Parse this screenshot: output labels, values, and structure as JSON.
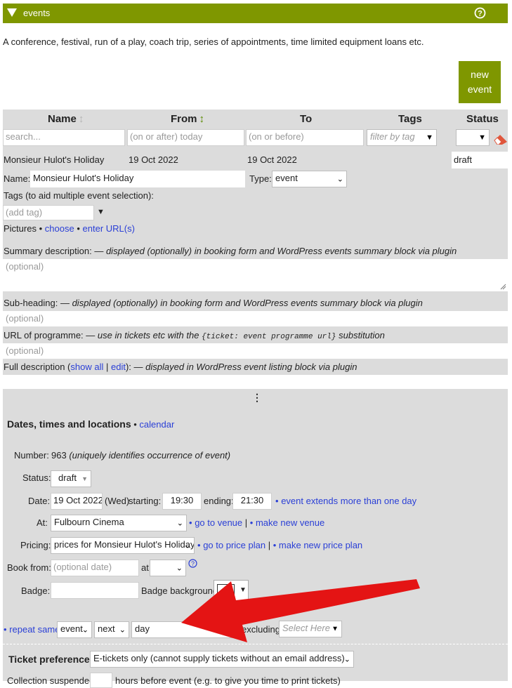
{
  "header": {
    "title": "events",
    "help_icon": "help-circle-icon",
    "bg": "#7f9700"
  },
  "intro": "A conference, festival, run of a play, coach trip, series of appointments, time limited equipment loans etc.",
  "new_event": {
    "line1": "new",
    "line2": "event",
    "bg": "#7f9700"
  },
  "columns": {
    "name": "Name",
    "from": "From",
    "to": "To",
    "tags": "Tags",
    "status": "Status"
  },
  "filters": {
    "search": "search...",
    "from": "(on or after) today",
    "to": "(on or before)",
    "tags": "filter by tag"
  },
  "event_row": {
    "name": "Monsieur Hulot's Holiday",
    "from": "19 Oct 2022",
    "to": "19 Oct 2022",
    "status": "draft"
  },
  "detail": {
    "name_label": "Name:",
    "name_value": "Monsieur Hulot's Holiday",
    "type_label": "Type:",
    "type_value": "event",
    "tags_label": "Tags (to aid multiple event selection):",
    "tags_placeholder": "(add tag)",
    "pictures_label": "Pictures",
    "pictures_choose": "choose",
    "pictures_url": "enter URL(s)",
    "bullet": "•",
    "summary_label": "Summary description:",
    "summary_note": "— displayed (optionally) in booking form and WordPress events summary block via plugin",
    "optional": "(optional)",
    "subheading_label": "Sub-heading:",
    "subheading_note": "— displayed (optionally) in booking form and WordPress events summary block via plugin",
    "url_label": "URL of programme:",
    "url_note_a": "— use in tickets etc with the",
    "url_code": "{ticket: event programme url}",
    "url_note_b": "substitution",
    "full_label": "Full description (",
    "full_show": "show all",
    "full_sep": "|",
    "full_edit": "edit",
    "full_close": "):",
    "full_note": "— displayed in WordPress event listing block via plugin",
    "dots": "⋮"
  },
  "dates": {
    "heading": "Dates, times and locations",
    "calendar": "calendar",
    "number_label": "Number:",
    "number_value": "963",
    "number_note": "(uniquely identifies occurrence of event)",
    "status_label": "Status:",
    "status_value": "draft",
    "date_label": "Date:",
    "date_value": "19 Oct 2022",
    "day": "(Wed)",
    "starting": "starting:",
    "start_time": "19:30",
    "ending": "ending:",
    "end_time": "21:30",
    "extends": "event extends more than one day",
    "at_label": "At:",
    "venue": "Fulbourn Cinema",
    "go_venue": "go to venue",
    "sep": "|",
    "new_venue": "make new venue",
    "pricing_label": "Pricing:",
    "pricing_value": "prices for Monsieur Hulot's Holiday",
    "go_price": "go to price plan",
    "new_price": "make new price plan",
    "book_label": "Book from:",
    "book_placeholder": "(optional date)",
    "at_word": "at",
    "badge_label": "Badge:",
    "badge_bg_label": "Badge background:",
    "repeat": "repeat same",
    "repeat_what": "event",
    "repeat_next": "next",
    "repeat_unit": "day",
    "excluding": "excluding",
    "select_here": "Select Here"
  },
  "ticket": {
    "label": "Ticket preference:",
    "value": "E-tickets only (cannot supply tickets without an email address)",
    "collection": "Collection suspended:",
    "collection_note": "hours before event (e.g. to give you time to print tickets)"
  },
  "colors": {
    "accent": "#7f9700",
    "arrow": "#e41414",
    "link": "#2a3fd6",
    "panel": "#dcdcdc",
    "clear_icon": "#e0563c"
  }
}
